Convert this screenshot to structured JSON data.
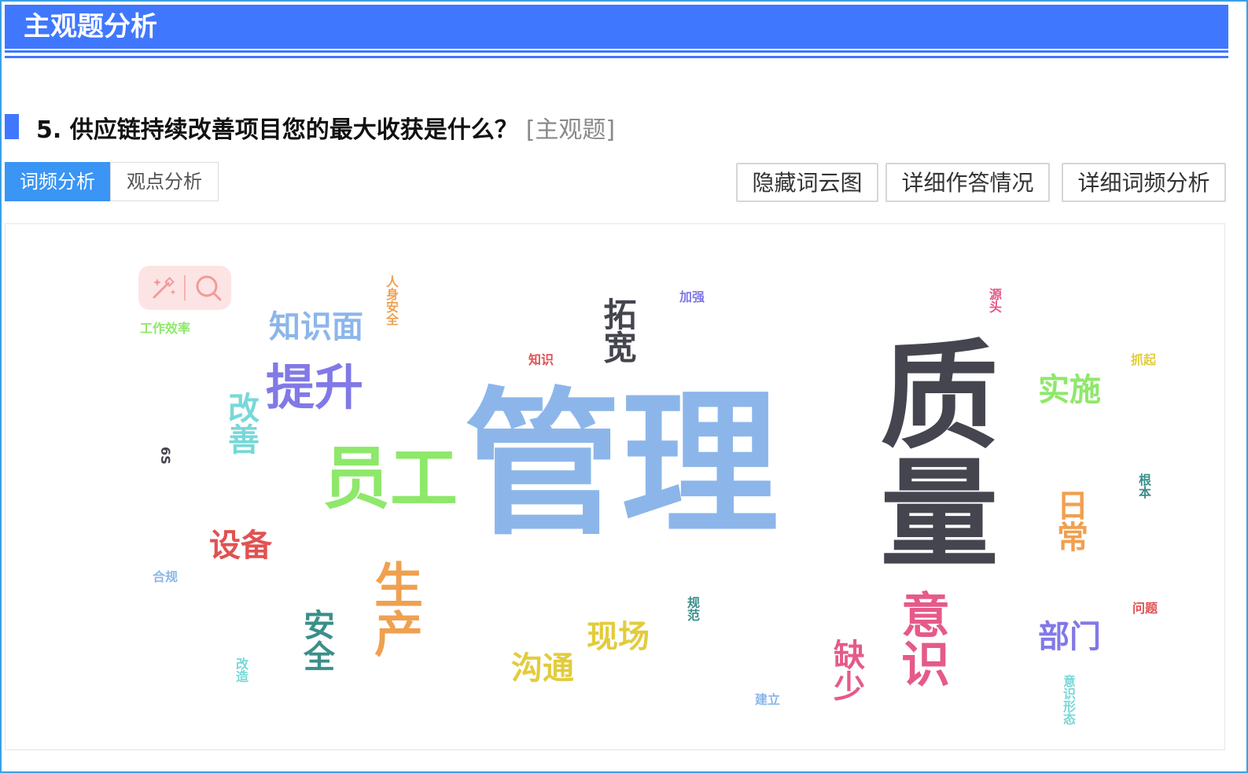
{
  "header": {
    "title": "主观题分析"
  },
  "question": {
    "text": "5. 供应链持续改善项目您的最大收获是什么？",
    "tag": "[主观题]"
  },
  "tabs": [
    {
      "label": "词频分析"
    },
    {
      "label": "观点分析"
    }
  ],
  "actions": {
    "hide_cloud": "隐藏词云图",
    "detail_answers": "详细作答情况",
    "detail_freq": "详细词频分析"
  },
  "colors": {
    "accent": "#4077ff",
    "frame": "#3aa0e8",
    "tab_active": "#3a95f5",
    "w_blue": "#8cb6ea",
    "w_dark": "#45454f",
    "w_green": "#8ee86a",
    "w_purple": "#8179e6",
    "w_cyan": "#77d8d8",
    "w_red": "#e05252",
    "w_orange": "#f0a050",
    "w_teal": "#3a8f8a",
    "w_yellow": "#e2cc3c",
    "w_pink": "#e55a8a"
  },
  "wordcloud": {
    "words": [
      "管理",
      "质量",
      "员工",
      "提升",
      "知识面",
      "拓宽",
      "实施",
      "日常",
      "设备",
      "生产",
      "安全",
      "现场",
      "沟通",
      "意识",
      "缺少",
      "部门",
      "改善",
      "人身安全",
      "加强",
      "工作效率",
      "知识",
      "源头",
      "抓起",
      "6S",
      "根本",
      "合规",
      "规范",
      "问题",
      "建立",
      "改造",
      "意识形态"
    ]
  },
  "icons": {
    "toolbox": [
      "magic-wand-icon",
      "search-icon"
    ]
  }
}
